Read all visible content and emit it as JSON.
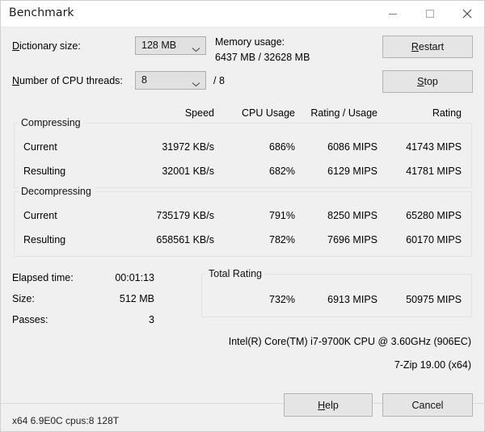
{
  "window": {
    "title": "Benchmark",
    "controls": [
      {
        "name": "minimize",
        "glyph": "minimize-icon"
      },
      {
        "name": "maximize",
        "glyph": "maximize-icon"
      },
      {
        "name": "close",
        "glyph": "close-icon"
      }
    ]
  },
  "settings": {
    "dictionary_label": "Dictionary size:",
    "dictionary_label_accel": "D",
    "dictionary_value": "128 MB",
    "threads_label": "Number of CPU threads:",
    "threads_label_accel": "N",
    "threads_value": "8",
    "threads_total": "/ 8"
  },
  "memory": {
    "label": "Memory usage:",
    "value": "6437 MB / 32628 MB"
  },
  "actions": {
    "restart": "Restart",
    "restart_accel": "R",
    "stop": "Stop",
    "stop_accel": "S"
  },
  "table": {
    "headers": [
      "Speed",
      "CPU Usage",
      "Rating / Usage",
      "Rating"
    ],
    "groups": [
      {
        "title": "Compressing",
        "rows": [
          {
            "label": "Current",
            "values": [
              "31972 KB/s",
              "686%",
              "6086 MIPS",
              "41743 MIPS"
            ]
          },
          {
            "label": "Resulting",
            "values": [
              "32001 KB/s",
              "682%",
              "6129 MIPS",
              "41781 MIPS"
            ]
          }
        ]
      },
      {
        "title": "Decompressing",
        "rows": [
          {
            "label": "Current",
            "values": [
              "735179 KB/s",
              "791%",
              "8250 MIPS",
              "65280 MIPS"
            ]
          },
          {
            "label": "Resulting",
            "values": [
              "658561 KB/s",
              "782%",
              "7696 MIPS",
              "60170 MIPS"
            ]
          }
        ]
      }
    ]
  },
  "stats": {
    "elapsed_label": "Elapsed time:",
    "elapsed_value": "00:01:13",
    "size_label": "Size:",
    "size_value": "512 MB",
    "passes_label": "Passes:",
    "passes_value": "3"
  },
  "total_rating": {
    "title": "Total Rating",
    "cpu_usage": "732%",
    "rating_usage": "6913 MIPS",
    "rating": "50975 MIPS"
  },
  "info": {
    "cpu": "Intel(R) Core(TM) i7-9700K CPU @ 3.60GHz (906EC)",
    "version": "7-Zip 19.00 (x64)"
  },
  "statusbar": {
    "text": "x64 6.9E0C cpus:8 128T"
  },
  "footer": {
    "help": "Help",
    "help_accel": "H",
    "cancel": "Cancel"
  },
  "colors": {
    "dialog_bg": "#f0f0f0",
    "titlebar_bg": "#ffffff",
    "button_bg": "#e5e5e5",
    "combo_bg": "#e1e1e1",
    "border": "#b4b4b4",
    "group_border": "#e2e2e2",
    "text": "#000000"
  }
}
